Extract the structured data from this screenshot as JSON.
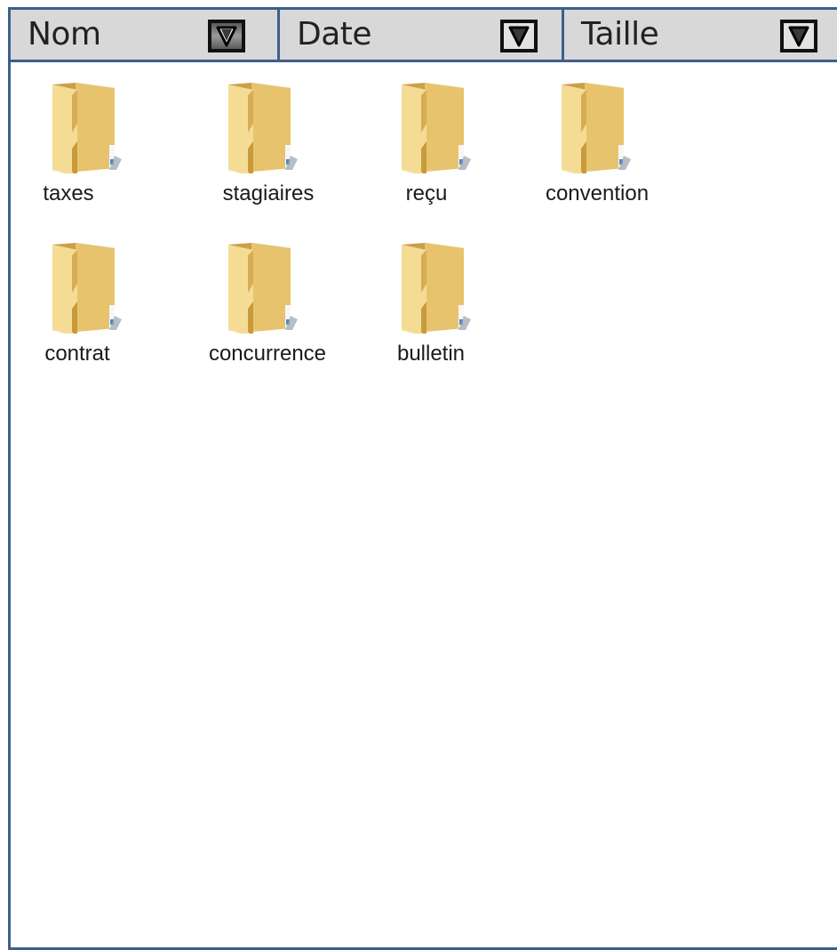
{
  "columns": [
    {
      "label": "Nom",
      "sort_icon": "sort-down-triangle-icon"
    },
    {
      "label": "Date",
      "sort_icon": "sort-down-triangle-icon"
    },
    {
      "label": "Taille",
      "sort_icon": "sort-down-triangle-icon"
    }
  ],
  "files": [
    {
      "name": "taxes",
      "icon": "folder-icon"
    },
    {
      "name": "stagiaires",
      "icon": "folder-icon"
    },
    {
      "name": "reçu",
      "icon": "folder-icon"
    },
    {
      "name": "convention",
      "icon": "folder-icon"
    },
    {
      "name": "contrat",
      "icon": "folder-icon"
    },
    {
      "name": "concurrence",
      "icon": "folder-icon"
    },
    {
      "name": "bulletin",
      "icon": "folder-icon"
    }
  ],
  "colors": {
    "border": "#3e5f8c",
    "header_bg": "#d8d8d8",
    "folder_front": "#f3d88c",
    "folder_back": "#c89f3c"
  }
}
